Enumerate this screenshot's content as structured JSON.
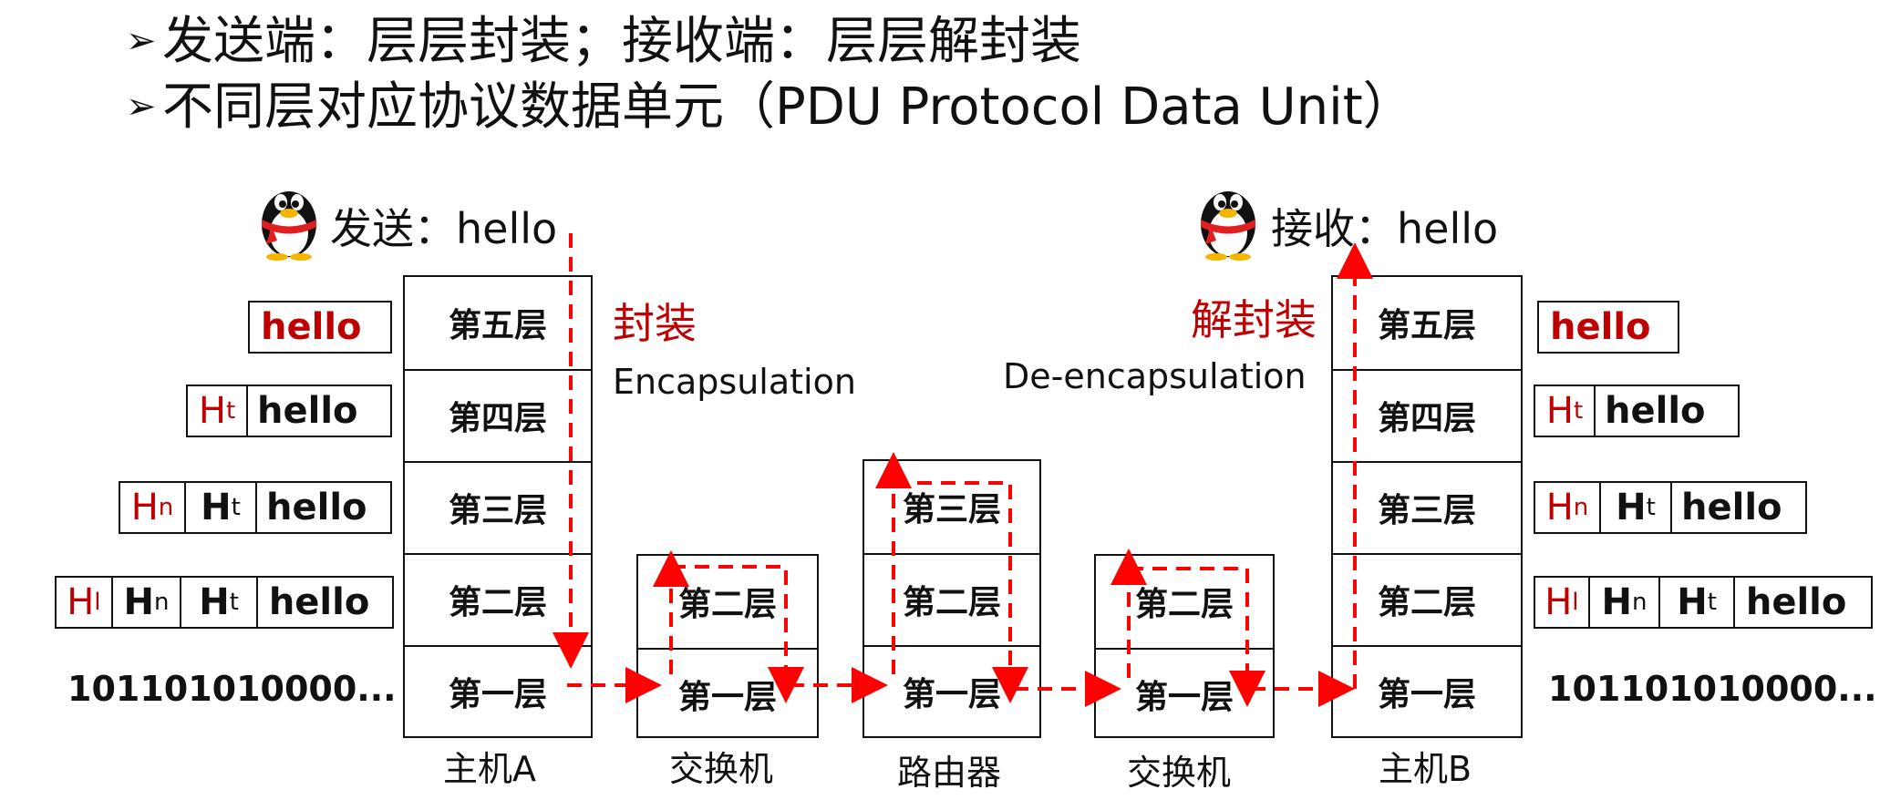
{
  "bullets": [
    "发送端：层层封装；接收端：层层解封装",
    "不同层对应协议数据单元（PDU Protocol Data Unit）"
  ],
  "bullet_arrow": "➢",
  "sender": {
    "caption": "发送：hello"
  },
  "receiver": {
    "caption": "接收：hello"
  },
  "encapsulation": {
    "title": "封装",
    "subtitle": "Encapsulation"
  },
  "decapsulation": {
    "title": "解封装",
    "subtitle": "De-encapsulation"
  },
  "layers": {
    "l5": "第五层",
    "l4": "第四层",
    "l3": "第三层",
    "l2": "第二层",
    "l1": "第一层"
  },
  "devices": {
    "host_a": "主机A",
    "switch_1": "交换机",
    "router": "路由器",
    "switch_2": "交换机",
    "host_b": "主机B"
  },
  "pdu": {
    "hello": "hello",
    "ht_main": "H",
    "ht_sub": "t",
    "hn_main": "H",
    "hn_sub": "n",
    "hl_main": "H",
    "hl_sub": "l",
    "bits": "101101010000..."
  },
  "colors": {
    "accent_red": "#c00000",
    "arrow_red": "#ff0000",
    "text": "#111111"
  }
}
